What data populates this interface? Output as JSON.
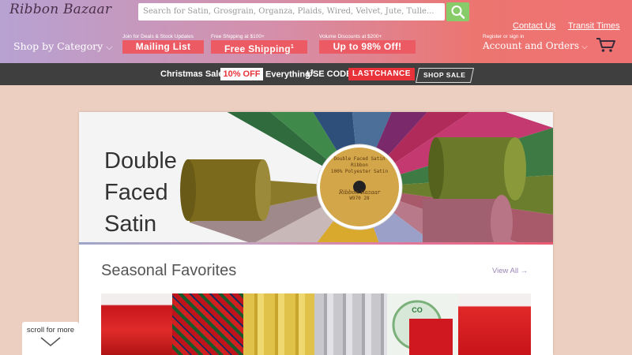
{
  "header": {
    "logo": "Ribbon Bazaar",
    "search_placeholder": "Search for Satin, Grosgrain, Organza, Plaids, Wired, Velvet, Jute, Tulle...",
    "contact_us": "Contact Us",
    "transit_times": "Transit Times",
    "shop_by_category": "Shop by Category",
    "promos": [
      {
        "small": "Join for Deals & Stock Updates",
        "label": "Mailing List"
      },
      {
        "small": "Free Shipping at $100+",
        "label": "Free Shipping",
        "sup": "1"
      },
      {
        "small": "Volume Discounts at $200+",
        "label": "Up to 98% Off!"
      }
    ],
    "account_small": "Register or sign in",
    "account_label": "Account and Orders"
  },
  "sale_bar": {
    "prefix": "Christmas Sale:",
    "percent": "10% OFF",
    "middle": "Everything",
    "sup": "2",
    "use_code": "USE CODE",
    "code": "LASTCHANCE",
    "button": "SHOP SALE"
  },
  "hero": {
    "title_lines": [
      "Double",
      "Faced",
      "Satin"
    ],
    "spool_label_top": "Double Faced Satin Ribbon",
    "spool_label_mid": "100% Polyester Satin",
    "spool_logo": "Ribbon Bazaar",
    "spool_code": "W970 28"
  },
  "seasonal": {
    "title": "Seasonal Favorites",
    "view_all": "View All →"
  },
  "scroll_hint": "scroll for more",
  "colors": {
    "sale_red": "#e8323a",
    "promo_box": "#ec5a63",
    "search_button": "#88cc6a",
    "link_purple": "#9b84b8"
  }
}
